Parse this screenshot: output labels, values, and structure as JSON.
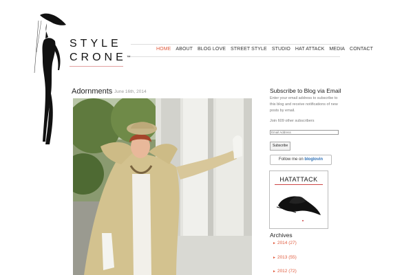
{
  "site": {
    "logo_line1": "STYLE",
    "logo_line2": "CRONE"
  },
  "nav": {
    "items": [
      "HOME",
      "ABOUT",
      "BLOG LOVE",
      "STREET STYLE",
      "STUDIO",
      "HAT ATTACK",
      "MEDIA",
      "CONTACT"
    ],
    "active_index": 0,
    "active_color": "#e05a3c"
  },
  "post": {
    "title": "Adornments",
    "date": "June 16th, 2014"
  },
  "sidebar": {
    "subscribe_title": "Subscribe to Blog via Email",
    "subscribe_desc": "Enter your email address to subscribe to this blog and receive notifications of new posts by email.",
    "subscriber_count": "Join 609 other subscribers",
    "email_placeholder": "Email Address",
    "subscribe_button": "Subscribe",
    "bloglovin_prefix": "Follow me on ",
    "bloglovin_brand": "bloglovin",
    "hat_attack_title": "HATATTACK",
    "archives_title": "Archives",
    "archives": [
      {
        "year": "2014",
        "count": "(27)"
      },
      {
        "year": "2013",
        "count": "(55)"
      },
      {
        "year": "2012",
        "count": "(72)"
      }
    ]
  },
  "colors": {
    "accent": "#e05a3c",
    "text": "#222222",
    "muted": "#777777"
  },
  "icons": [
    "woman-silhouette-logo-icon",
    "hat-icon",
    "triangle-right-icon"
  ]
}
